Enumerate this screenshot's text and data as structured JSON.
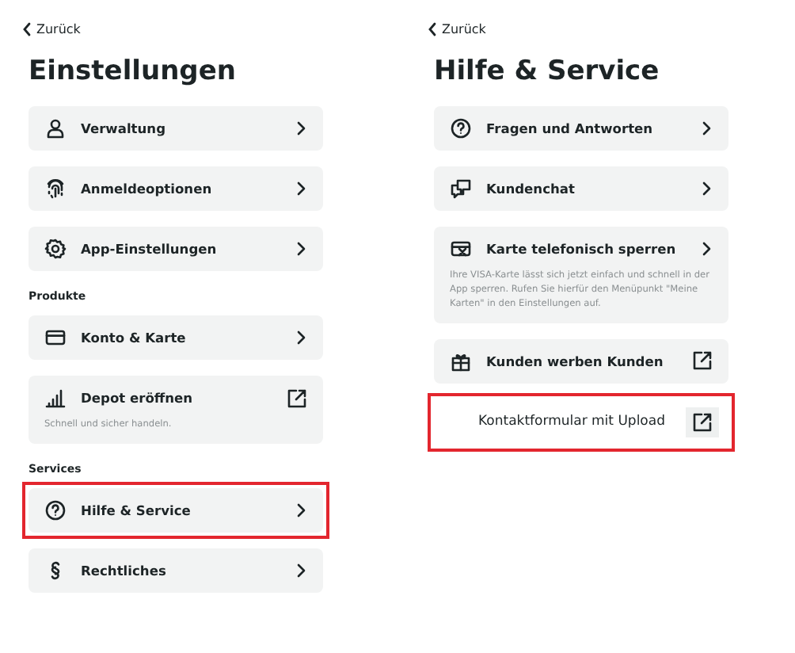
{
  "screens": [
    {
      "back": "Zurück",
      "title": "Einstellungen",
      "rows": [
        {
          "kind": "nav",
          "label": "Verwaltung",
          "highlighted": false
        },
        {
          "kind": "nav",
          "label": "Anmeldeoptionen",
          "highlighted": false
        },
        {
          "kind": "nav",
          "label": "App-Einstellungen",
          "highlighted": false
        },
        {
          "kind": "section",
          "label": "Produkte"
        },
        {
          "kind": "nav",
          "label": "Konto & Karte",
          "highlighted": false
        },
        {
          "kind": "external",
          "label": "Depot eröffnen",
          "subtitle": "Schnell und sicher handeln.",
          "highlighted": false
        },
        {
          "kind": "section",
          "label": "Services"
        },
        {
          "kind": "nav",
          "label": "Hilfe & Service",
          "highlighted": true
        },
        {
          "kind": "nav",
          "label": "Rechtliches",
          "highlighted": false
        }
      ]
    },
    {
      "back": "Zurück",
      "title": "Hilfe & Service",
      "rows": [
        {
          "kind": "nav",
          "label": "Fragen und Antworten",
          "highlighted": false
        },
        {
          "kind": "nav",
          "label": "Kundenchat",
          "highlighted": false
        },
        {
          "kind": "nav",
          "label": "Karte telefonisch sperren",
          "subtitle": "Ihre VISA-Karte lässt sich jetzt einfach und schnell in der App sperren. Rufen Sie hierfür den Menüpunkt \"Meine Karten\" in den Einstellungen auf.",
          "highlighted": false
        },
        {
          "kind": "external",
          "label": "Kunden werben Kunden",
          "highlighted": false
        },
        {
          "kind": "link",
          "label": "Kontaktformular mit Upload",
          "highlighted": true
        }
      ]
    }
  ]
}
